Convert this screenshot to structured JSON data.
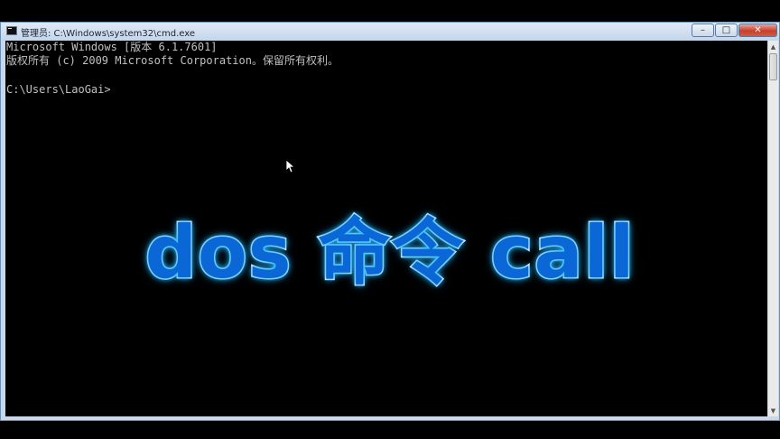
{
  "window": {
    "title": "管理员: C:\\Windows\\system32\\cmd.exe",
    "controls": {
      "minimize": "–",
      "maximize": "□",
      "close": "✕"
    }
  },
  "console": {
    "lines": [
      "Microsoft Windows [版本 6.1.7601]",
      "版权所有 (c) 2009 Microsoft Corporation。保留所有权利。",
      "",
      "C:\\Users\\LaoGai>"
    ]
  },
  "overlay": {
    "title": "dos 命令 call"
  },
  "icons": {
    "window_icon": "cmd-icon",
    "cursor": "mouse-pointer-icon",
    "scroll_up": "arrow-up-icon",
    "scroll_down": "arrow-down-icon"
  },
  "colors": {
    "console_bg": "#000000",
    "console_text": "#c0c0c0",
    "overlay_fill": "#0b67d6",
    "overlay_stroke": "#ffffff"
  }
}
